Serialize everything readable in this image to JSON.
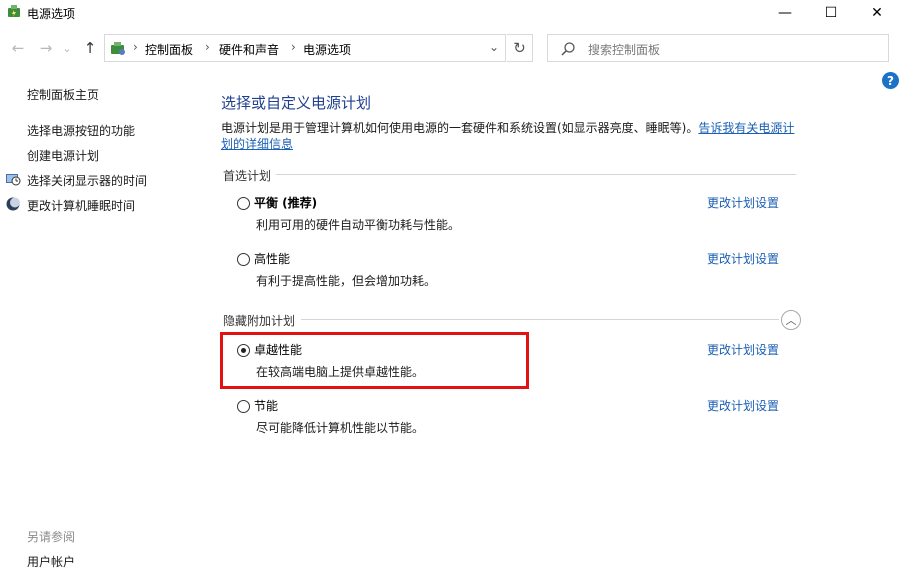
{
  "window": {
    "title": "电源选项",
    "controls": {
      "minimize": "—",
      "maximize": "☐",
      "close": "✕"
    }
  },
  "nav": {
    "back": "←",
    "forward": "→",
    "recent": "⌄",
    "up": "↑",
    "breadcrumbs": [
      "控制面板",
      "硬件和声音",
      "电源选项"
    ],
    "separator": "›",
    "dropdown": "⌄",
    "refresh": "↻"
  },
  "search": {
    "placeholder": "搜索控制面板"
  },
  "help": {
    "label": "?"
  },
  "sidebar": {
    "home": "控制面板主页",
    "links": [
      {
        "label": "选择电源按钮的功能",
        "icon": null
      },
      {
        "label": "创建电源计划",
        "icon": null
      },
      {
        "label": "选择关闭显示器的时间",
        "icon": "display-clock-icon"
      },
      {
        "label": "更改计算机睡眠时间",
        "icon": "moon-icon"
      }
    ],
    "see_also": "另请参阅",
    "user_accounts": "用户帐户"
  },
  "main": {
    "title": "选择或自定义电源计划",
    "description": "电源计划是用于管理计算机如何使用电源的一套硬件和系统设置(如显示器亮度、睡眠等)。",
    "description_link": "告诉我有关电源计划的详细信息",
    "preferred_label": "首选计划",
    "hidden_label": "隐藏附加计划",
    "collapse": "︿",
    "change_link": "更改计划设置",
    "plans": [
      {
        "name": "平衡 (推荐)",
        "desc": "利用可用的硬件自动平衡功耗与性能。",
        "selected": false,
        "bold": true
      },
      {
        "name": "高性能",
        "desc": "有利于提高性能，但会增加功耗。",
        "selected": false,
        "bold": false
      },
      {
        "name": "卓越性能",
        "desc": "在较高端电脑上提供卓越性能。",
        "selected": true,
        "bold": false
      },
      {
        "name": "节能",
        "desc": "尽可能降低计算机性能以节能。",
        "selected": false,
        "bold": false
      }
    ]
  },
  "annotation": {
    "color": "#e31212"
  }
}
